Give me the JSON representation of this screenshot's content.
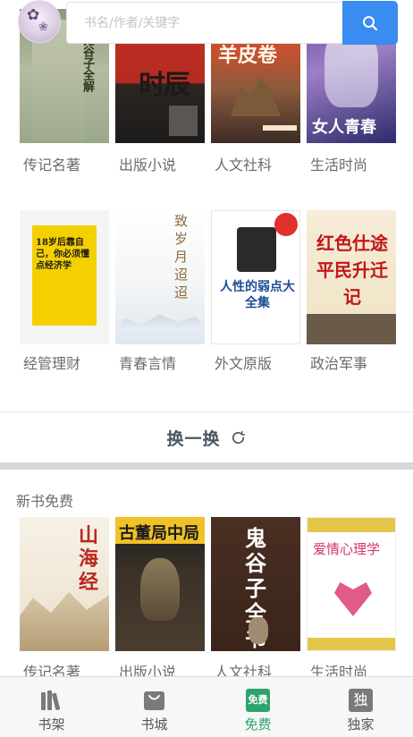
{
  "search": {
    "placeholder": "书名/作者/关键字"
  },
  "categories_row1": [
    {
      "label": "传记名著",
      "cover_text": "鬼谷子全解"
    },
    {
      "label": "出版小说",
      "cover_text": "时辰"
    },
    {
      "label": "人文社科",
      "cover_text": "羊皮卷"
    },
    {
      "label": "生活时尚",
      "cover_text": "女人青春"
    }
  ],
  "categories_row2": [
    {
      "label": "经管理财",
      "cover_text": "18岁后靠自己，你必须懂点经济学"
    },
    {
      "label": "青春言情",
      "cover_text": "致岁月迢迢"
    },
    {
      "label": "外文原版",
      "cover_text": "人性的弱点大全集"
    },
    {
      "label": "政治军事",
      "cover_text": "红色仕途 平民升迁记"
    }
  ],
  "refresh": {
    "label": "换一换"
  },
  "free_section": {
    "title": "新书免费",
    "items": [
      {
        "label": "传记名著",
        "cover_text": "山海经"
      },
      {
        "label": "出版小说",
        "cover_text": "古董局中局"
      },
      {
        "label": "人文社科",
        "cover_text": "鬼谷子全书"
      },
      {
        "label": "生活时尚",
        "cover_text": "爱情心理学"
      }
    ]
  },
  "tabbar": {
    "items": [
      {
        "label": "书架",
        "icon": "bookshelf-icon",
        "active": false
      },
      {
        "label": "书城",
        "icon": "bookstore-bag-icon",
        "active": false
      },
      {
        "label": "免费",
        "icon": "free-badge-icon",
        "active": true,
        "badge": "免费"
      },
      {
        "label": "独家",
        "icon": "exclusive-badge-icon",
        "active": false,
        "badge": "独"
      }
    ]
  },
  "colors": {
    "accent_blue": "#3b8cf0",
    "active_green": "#2fa36e",
    "text_gray": "#6b6b6b"
  }
}
